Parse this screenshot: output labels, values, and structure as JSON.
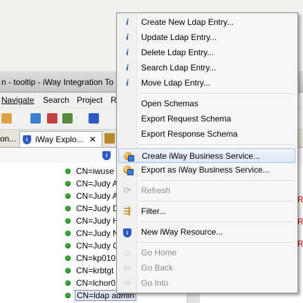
{
  "window": {
    "title": "n - tooltip - iWay Integration To"
  },
  "menubar": {
    "items": [
      "Navigate",
      "Search",
      "Project",
      "R"
    ]
  },
  "tabs": {
    "first": "on...",
    "active": "iWay Explo...",
    "close_glyph": "✕"
  },
  "tree": {
    "rows": [
      "CN=iwuse",
      "CN=Judy A",
      "CN=Judy A",
      "CN=Judy D",
      "CN=Judy H",
      "CN=Judy N",
      "CN=Judy C",
      "CN=kp010",
      "CN=krbtgt",
      "CN=lchor0",
      "CN=ldap admin"
    ],
    "right_edge_marks": [
      "R",
      "R",
      "R"
    ]
  },
  "context_menu": {
    "items": [
      {
        "label": "Create New Ldap Entry...",
        "icon": "info-icon",
        "disabled": false
      },
      {
        "label": "Update Ldap Entry...",
        "icon": "info-icon",
        "disabled": false
      },
      {
        "label": "Delete Ldap Entry...",
        "icon": "info-icon",
        "disabled": false
      },
      {
        "label": "Search Ldap Entry...",
        "icon": "info-icon",
        "disabled": false
      },
      {
        "label": "Move Ldap Entry...",
        "icon": "info-icon",
        "disabled": false
      },
      {
        "label": "Open Schemas",
        "icon": "",
        "disabled": false
      },
      {
        "label": "Export Request Schema",
        "icon": "",
        "disabled": false
      },
      {
        "label": "Export Response Schema",
        "icon": "",
        "disabled": false
      },
      {
        "label": "Create iWay Business Service...",
        "icon": "globe-service-icon",
        "disabled": false,
        "highlighted": true
      },
      {
        "label": "Export as iWay Business Service...",
        "icon": "globe-service-icon",
        "disabled": false
      },
      {
        "label": "Refresh",
        "icon": "refresh-icon",
        "disabled": true
      },
      {
        "label": "Filter...",
        "icon": "filter-icon",
        "disabled": false
      },
      {
        "label": "New iWay Resource...",
        "icon": "iway-shield-icon",
        "disabled": false
      },
      {
        "label": "Go Home",
        "icon": "home-icon",
        "disabled": true
      },
      {
        "label": "Go Back",
        "icon": "back-arrow-icon",
        "disabled": true
      },
      {
        "label": "Go Into",
        "icon": "forward-arrow-icon",
        "disabled": true
      }
    ]
  },
  "colors": {
    "highlight": "#dce7f5",
    "status_dot": "#3aa33a",
    "info_icon": "#1f4fa8"
  }
}
